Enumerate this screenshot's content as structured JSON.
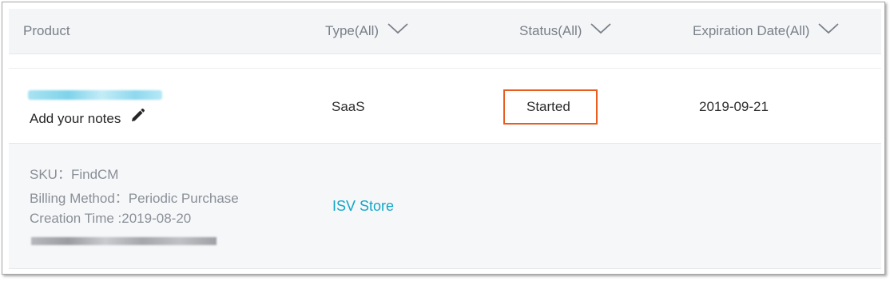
{
  "table": {
    "columns": [
      {
        "label": "Product"
      },
      {
        "label": "Type(All)"
      },
      {
        "label": "Status(All)"
      },
      {
        "label": "Expiration Date(All)"
      }
    ],
    "row": {
      "notes_label": "Add your notes",
      "type": "SaaS",
      "status": "Started",
      "expiration_date": "2019-09-21"
    },
    "detail": {
      "sku": "SKU：FindCM",
      "billing_method": "Billing Method：Periodic Purchase",
      "creation_time": "Creation Time :2019-08-20",
      "link_label": "ISV Store"
    }
  },
  "icons": {
    "header_filter": "chevron-down-icon",
    "notes_edit": "pencil-icon"
  },
  "colors": {
    "header_bg": "#f4f5f7",
    "detail_bg": "#f6f7f9",
    "link": "#12a6c7",
    "status_highlight": "#e85d1d"
  }
}
